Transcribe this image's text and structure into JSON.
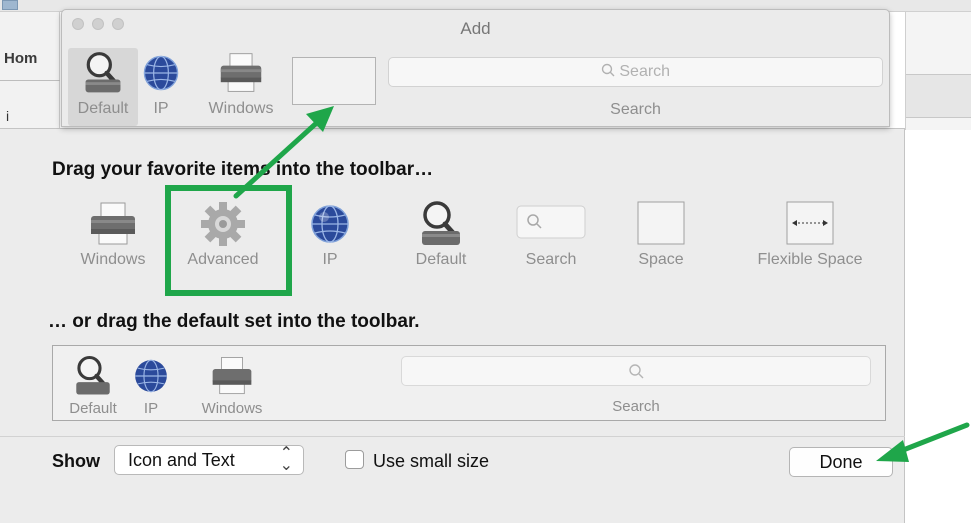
{
  "background": {
    "home_tab_label": "Hom",
    "left_fragment": "i"
  },
  "toolbar_window": {
    "title": "Add",
    "items": [
      {
        "label": "Default",
        "icon": "magnifier-icon"
      },
      {
        "label": "IP",
        "icon": "globe-icon"
      },
      {
        "label": "Windows",
        "icon": "printer-icon"
      }
    ],
    "search_placeholder": "Search",
    "search_label": "Search"
  },
  "customize": {
    "heading": "Drag your favorite items into the toolbar…",
    "palette": [
      {
        "label": "Windows",
        "icon": "printer-icon"
      },
      {
        "label": "Advanced",
        "icon": "gear-icon"
      },
      {
        "label": "IP",
        "icon": "globe-icon"
      },
      {
        "label": "Default",
        "icon": "magnifier-icon"
      },
      {
        "label": "Search",
        "icon": "search-field-icon"
      },
      {
        "label": "Space",
        "icon": "space-icon"
      },
      {
        "label": "Flexible Space",
        "icon": "flexible-space-icon"
      }
    ],
    "default_heading": "… or drag the default set into the toolbar.",
    "default_set": [
      {
        "label": "Default",
        "icon": "magnifier-icon"
      },
      {
        "label": "IP",
        "icon": "globe-icon"
      },
      {
        "label": "Windows",
        "icon": "printer-icon"
      }
    ],
    "default_search_label": "Search"
  },
  "footer": {
    "show_label": "Show",
    "show_value": "Icon and Text",
    "small_size_label": "Use small size",
    "small_size_checked": false,
    "done_label": "Done"
  },
  "colors": {
    "annotation_green": "#1fa64a"
  }
}
